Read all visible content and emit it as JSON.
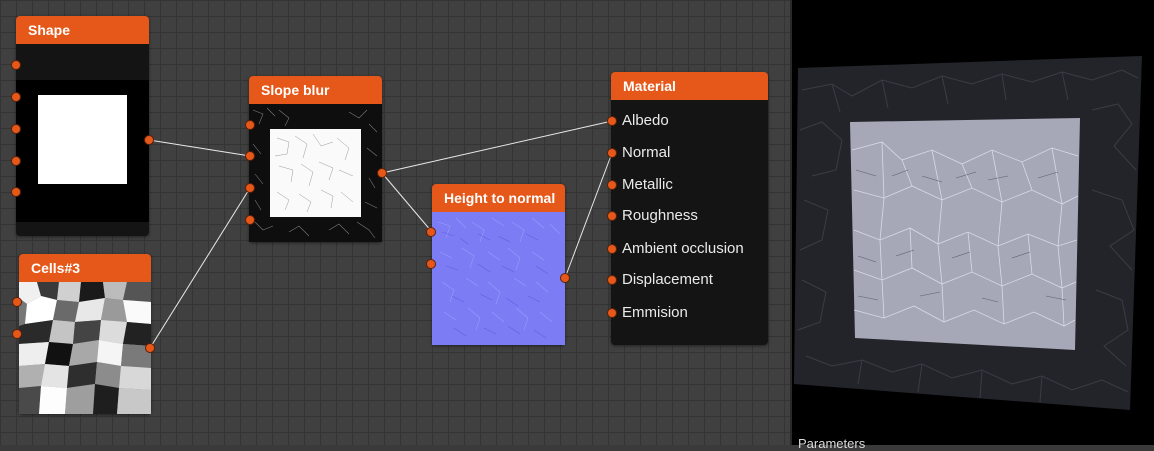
{
  "nodes": {
    "shape": {
      "title": "Shape"
    },
    "slope_blur": {
      "title": "Slope blur"
    },
    "cells": {
      "title": "Cells#3"
    },
    "height_to_normal": {
      "title": "Height to normal"
    },
    "material": {
      "title": "Material",
      "inputs": [
        "Albedo",
        "Normal",
        "Metallic",
        "Roughness",
        "Ambient occlusion",
        "Displacement",
        "Emmision"
      ]
    }
  },
  "colors": {
    "accent": "#e5581a",
    "node_body": "#141414",
    "graph_background": "#404040",
    "normal_map": "#7a7af5"
  },
  "viewport": {
    "label": "Parameters"
  }
}
